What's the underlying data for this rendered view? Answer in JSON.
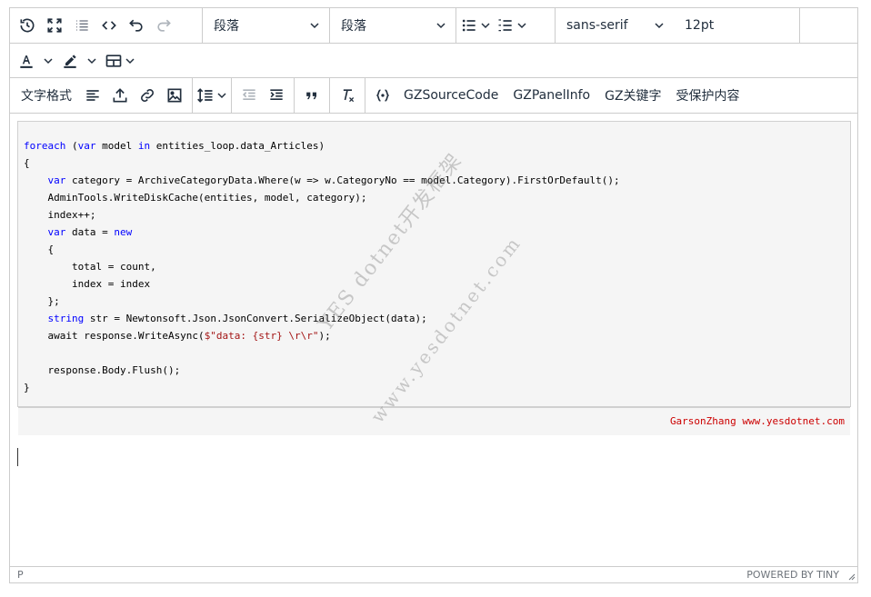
{
  "toolbar": {
    "block_format_1": "段落",
    "block_format_2": "段落",
    "font_family": "sans-serif",
    "font_size": "12pt",
    "text_format": "文字格式",
    "gz_source_code": "GZSourceCode",
    "gz_panel_info": "GZPanelInfo",
    "gz_keyword": "GZ关键字",
    "protected_content": "受保护内容"
  },
  "icons": {
    "row1": [
      "history-icon",
      "fullscreen-icon",
      "list-outline-icon",
      "code-icon",
      "undo-icon",
      "redo-icon"
    ],
    "row2": [
      "text-color-icon",
      "highlight-icon",
      "table-icon"
    ],
    "row3": [
      "align-left-icon",
      "upload-icon",
      "link-icon",
      "image-icon",
      "line-height-icon",
      "outdent-icon",
      "indent-icon",
      "blockquote-icon",
      "remove-format-icon",
      "code-sample-icon"
    ]
  },
  "code": {
    "lines": [
      "foreach (var model in entities_loop.data_Articles)",
      "{",
      "    var category = ArchiveCategoryData.Where(w => w.CategoryNo == model.Category).FirstOrDefault();",
      "    AdminTools.WriteDiskCache(entities, model, category);",
      "    index++;",
      "    var data = new",
      "    {",
      "        total = count,",
      "        index = index",
      "    };",
      "    string str = Newtonsoft.Json.JsonConvert.SerializeObject(data);",
      "    await response.WriteAsync($\"data: {str} \\r\\r\");",
      "",
      "    response.Body.Flush();",
      "}"
    ],
    "signature": "GarsonZhang www.yesdotnet.com"
  },
  "watermark": {
    "line1": "YES dotnet开发框架",
    "line2": "www.yesdotnet.com"
  },
  "statusbar": {
    "path": "P",
    "branding": "POWERED BY TINY"
  },
  "colors": {
    "keyword": "#0000ff",
    "string": "#a31515",
    "signature": "#cc0000",
    "border": "#cccccc",
    "code_bg": "#f5f5f5"
  }
}
